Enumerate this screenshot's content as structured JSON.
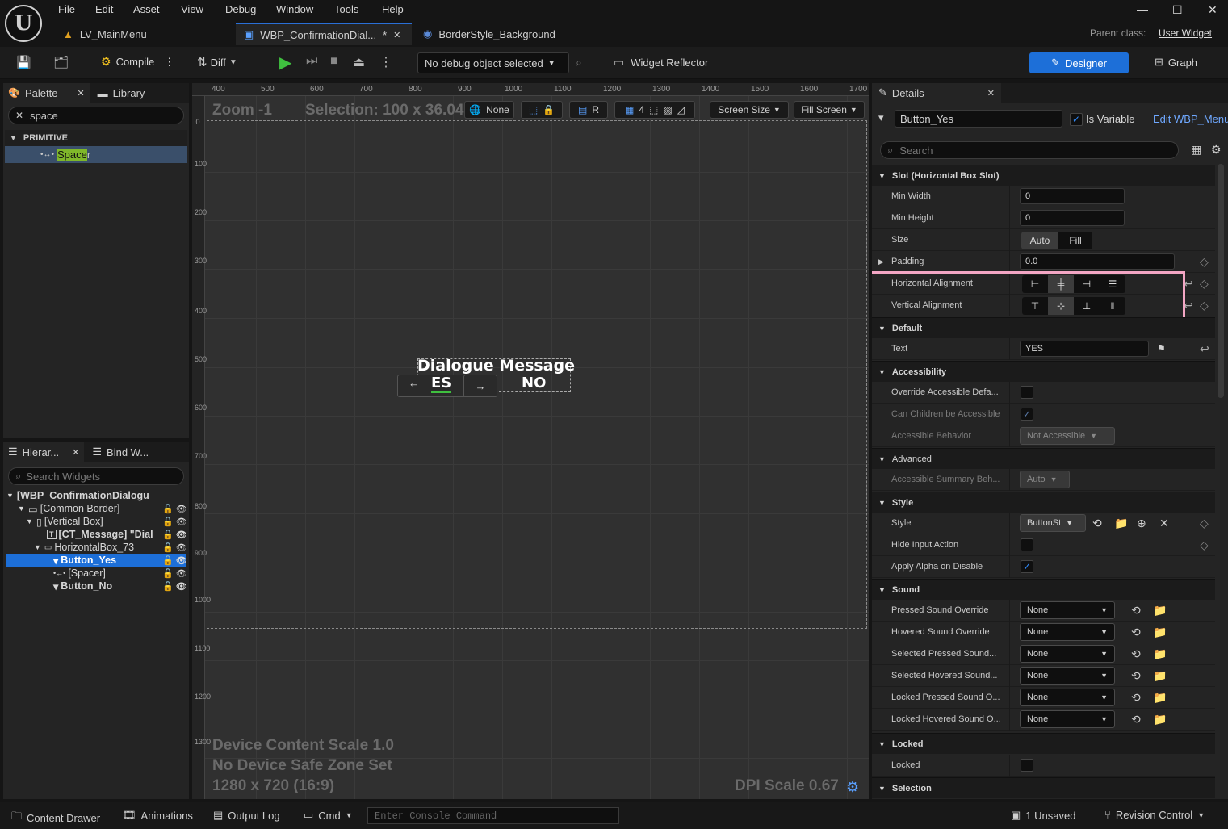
{
  "app": {
    "logo": "U"
  },
  "menu": [
    "File",
    "Edit",
    "Asset",
    "View",
    "Debug",
    "Window",
    "Tools",
    "Help"
  ],
  "tabs": [
    {
      "label": "LV_MainMenu",
      "icon": "level-icon"
    },
    {
      "label": "WBP_ConfirmationDial...",
      "icon": "widget-blueprint-icon",
      "modified": "*"
    },
    {
      "label": "BorderStyle_Background",
      "icon": "style-asset-icon"
    }
  ],
  "parent_class": {
    "label": "Parent class:",
    "value": "User Widget"
  },
  "window_controls": {
    "minimize": "—",
    "maximize": "☐",
    "close": "✕"
  },
  "toolbar": {
    "compile": "Compile",
    "diff": "Diff",
    "debug_object": "No debug object selected",
    "widget_reflector": "Widget Reflector",
    "designer": "Designer",
    "graph": "Graph"
  },
  "palette": {
    "tab": "Palette",
    "library_tab": "Library",
    "search_value": "space",
    "category": "PRIMITIVE",
    "item": {
      "highlight": "Space",
      "rest": "r"
    }
  },
  "hierarchy": {
    "tab": "Hierar...",
    "bind_tab": "Bind W...",
    "search_placeholder": "Search Widgets",
    "rows": [
      {
        "label": "[WBP_ConfirmationDialogu"
      },
      {
        "label": "[Common Border]"
      },
      {
        "label": "[Vertical Box]"
      },
      {
        "label": "[CT_Message] \"Dial"
      },
      {
        "label": "HorizontalBox_73"
      },
      {
        "label": "Button_Yes"
      },
      {
        "label": "[Spacer]"
      },
      {
        "label": "Button_No"
      }
    ]
  },
  "viewport": {
    "zoom": "Zoom -1",
    "selection": "Selection: 100 x 36.04",
    "none_btn": "None",
    "r_btn": "R",
    "grid_num": "4",
    "screen_size": "Screen Size",
    "fill_screen": "Fill Screen",
    "ruler_top": [
      "400",
      "500",
      "600",
      "700",
      "800",
      "900",
      "1000",
      "1100",
      "1200",
      "1300",
      "1400",
      "1500",
      "1600",
      "1700"
    ],
    "ruler_left": [
      "0",
      "100",
      "200",
      "300",
      "400",
      "500",
      "600",
      "700",
      "800",
      "900",
      "1000",
      "1100",
      "1200",
      "1300"
    ],
    "dialog_message": "Dialogue Message",
    "yes_partial": "ES",
    "no_text": "NO",
    "arrow_left": "←",
    "arrow_right": "→",
    "device_scale": "Device Content Scale 1.0",
    "safe_zone": "No Device Safe Zone Set",
    "resolution": "1280 x 720 (16:9)",
    "dpi": "DPI Scale 0.67"
  },
  "details": {
    "tab": "Details",
    "widget_name": "Button_Yes",
    "is_variable": "Is Variable",
    "edit_link": "Edit WBP_Menu",
    "search_placeholder": "Search",
    "sections": {
      "slot": "Slot (Horizontal Box Slot)",
      "default": "Default",
      "accessibility": "Accessibility",
      "advanced": "Advanced",
      "style": "Style",
      "sound": "Sound",
      "locked": "Locked",
      "selection": "Selection"
    },
    "props": {
      "min_width": {
        "label": "Min Width",
        "value": "0"
      },
      "min_height": {
        "label": "Min Height",
        "value": "0"
      },
      "size": {
        "label": "Size",
        "auto": "Auto",
        "fill": "Fill"
      },
      "padding": {
        "label": "Padding",
        "value": "0.0"
      },
      "h_align": {
        "label": "Horizontal Alignment"
      },
      "v_align": {
        "label": "Vertical Alignment"
      },
      "text": {
        "label": "Text",
        "value": "YES"
      },
      "override_acc": {
        "label": "Override Accessible Defa..."
      },
      "children_acc": {
        "label": "Can Children be Accessible"
      },
      "acc_behavior": {
        "label": "Accessible Behavior",
        "value": "Not Accessible"
      },
      "acc_summary": {
        "label": "Accessible Summary Beh...",
        "value": "Auto"
      },
      "style": {
        "label": "Style",
        "value": "ButtonSt"
      },
      "hide_input": {
        "label": "Hide Input Action"
      },
      "apply_alpha": {
        "label": "Apply Alpha on Disable"
      },
      "pressed_sound": {
        "label": "Pressed Sound Override",
        "value": "None"
      },
      "hovered_sound": {
        "label": "Hovered Sound Override",
        "value": "None"
      },
      "sel_pressed": {
        "label": "Selected Pressed Sound...",
        "value": "None"
      },
      "sel_hovered": {
        "label": "Selected Hovered Sound...",
        "value": "None"
      },
      "locked_pressed": {
        "label": "Locked Pressed Sound O...",
        "value": "None"
      },
      "locked_hovered": {
        "label": "Locked Hovered Sound O...",
        "value": "None"
      },
      "locked": {
        "label": "Locked"
      }
    }
  },
  "bottom": {
    "content_drawer": "Content Drawer",
    "animations": "Animations",
    "output_log": "Output Log",
    "cmd": "Cmd",
    "console_placeholder": "Enter Console Command",
    "unsaved": "1 Unsaved",
    "revision": "Revision Control"
  },
  "colors": {
    "accent": "#1d6fd8",
    "highlight_box": "#f3a6c4",
    "search_highlight": "#7fb82a"
  }
}
